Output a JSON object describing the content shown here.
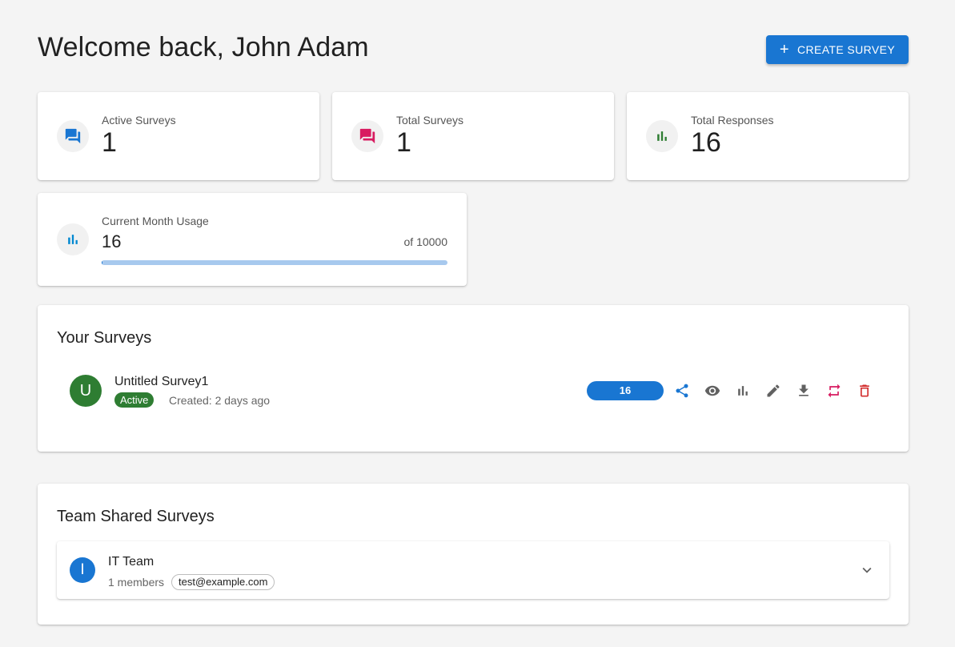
{
  "header": {
    "title": "Welcome back, John Adam",
    "create_button": {
      "icon": "plus-icon",
      "label": "CREATE SURVEY"
    }
  },
  "stats": [
    {
      "label": "Active Surveys",
      "value": "1",
      "icon": "forum-icon",
      "color": "#1976d2"
    },
    {
      "label": "Total Surveys",
      "value": "1",
      "icon": "forum-icon",
      "color": "#d81b60"
    },
    {
      "label": "Total Responses",
      "value": "16",
      "icon": "bar-chart-icon",
      "color": "#2e7d32"
    }
  ],
  "usage": {
    "label": "Current Month Usage",
    "value": "16",
    "limit_text": "of 10000",
    "progress_fraction": 0.0016,
    "icon": "bar-chart-icon",
    "color": "#0288d1"
  },
  "your_surveys": {
    "title": "Your Surveys",
    "items": [
      {
        "avatar_letter": "U",
        "avatar_color": "#2e7d32",
        "name": "Untitled Survey1",
        "status": "Active",
        "created": "Created: 2 days ago",
        "responses": "16 responses",
        "actions": [
          "share-icon",
          "view-icon",
          "analytics-icon",
          "edit-icon",
          "download-icon",
          "repeat-icon",
          "delete-icon"
        ]
      }
    ]
  },
  "team_surveys": {
    "title": "Team Shared Surveys",
    "teams": [
      {
        "avatar_letter": "I",
        "avatar_color": "#1976d2",
        "name": "IT Team",
        "members": "1 members",
        "member_emails": [
          "test@example.com"
        ]
      }
    ]
  },
  "colors": {
    "primary": "#1976d2",
    "success": "#2e7d32",
    "danger": "#d32f2f",
    "background": "#f4f4f4"
  }
}
